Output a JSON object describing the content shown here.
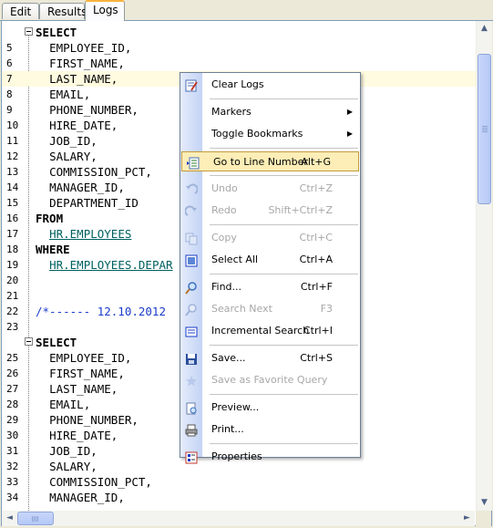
{
  "tabs": [
    {
      "label": "Edit"
    },
    {
      "label": "Results"
    },
    {
      "label": "Logs"
    }
  ],
  "code_lines": [
    {
      "num": "",
      "text": "SELECT",
      "style": "kw",
      "fold": true
    },
    {
      "num": "5",
      "text": "  EMPLOYEE_ID,"
    },
    {
      "num": "6",
      "text": "  FIRST_NAME,"
    },
    {
      "num": "7",
      "text": "  LAST_NAME,",
      "highlight": true
    },
    {
      "num": "8",
      "text": "  EMAIL,"
    },
    {
      "num": "9",
      "text": "  PHONE_NUMBER,"
    },
    {
      "num": "10",
      "text": "  HIRE_DATE,"
    },
    {
      "num": "11",
      "text": "  JOB_ID,"
    },
    {
      "num": "12",
      "text": "  SALARY,"
    },
    {
      "num": "13",
      "text": "  COMMISSION_PCT,"
    },
    {
      "num": "14",
      "text": "  MANAGER_ID,"
    },
    {
      "num": "15",
      "text": "  DEPARTMENT_ID"
    },
    {
      "num": "16",
      "text": "FROM",
      "style": "kw"
    },
    {
      "num": "17",
      "text": "  HR.EMPLOYEES",
      "style": "link"
    },
    {
      "num": "18",
      "text": "WHERE",
      "style": "kw"
    },
    {
      "num": "19",
      "text": "  HR.EMPLOYEES.DEPAR",
      "style": "link"
    },
    {
      "num": "20",
      "text": ""
    },
    {
      "num": "21",
      "text": ""
    },
    {
      "num": "22",
      "text": "/*------ 12.10.2012",
      "style": "cmt"
    },
    {
      "num": "23",
      "text": ""
    },
    {
      "num": "",
      "text": "SELECT",
      "style": "kw",
      "fold": true
    },
    {
      "num": "25",
      "text": "  EMPLOYEE_ID,"
    },
    {
      "num": "26",
      "text": "  FIRST_NAME,"
    },
    {
      "num": "27",
      "text": "  LAST_NAME,"
    },
    {
      "num": "28",
      "text": "  EMAIL,"
    },
    {
      "num": "29",
      "text": "  PHONE_NUMBER,"
    },
    {
      "num": "30",
      "text": "  HIRE_DATE,"
    },
    {
      "num": "31",
      "text": "  JOB_ID,"
    },
    {
      "num": "32",
      "text": "  SALARY,"
    },
    {
      "num": "33",
      "text": "  COMMISSION_PCT,"
    },
    {
      "num": "34",
      "text": "  MANAGER_ID,"
    }
  ],
  "menu": [
    {
      "label": "Clear Logs",
      "shortcut": "",
      "icon": "clear-logs-icon"
    },
    {
      "sep": true
    },
    {
      "label": "Markers",
      "submenu": true
    },
    {
      "label": "Toggle Bookmarks",
      "submenu": true
    },
    {
      "sep": true
    },
    {
      "label": "Go to Line Number",
      "shortcut": "Alt+G",
      "icon": "goto-line-icon",
      "selected": true
    },
    {
      "sep": true
    },
    {
      "label": "Undo",
      "shortcut": "Ctrl+Z",
      "disabled": true,
      "icon": "undo-icon"
    },
    {
      "label": "Redo",
      "shortcut": "Shift+Ctrl+Z",
      "disabled": true,
      "icon": "redo-icon"
    },
    {
      "sep": true
    },
    {
      "label": "Copy",
      "shortcut": "Ctrl+C",
      "disabled": true,
      "icon": "copy-icon"
    },
    {
      "label": "Select All",
      "shortcut": "Ctrl+A",
      "icon": "select-all-icon"
    },
    {
      "sep": true
    },
    {
      "label": "Find...",
      "shortcut": "Ctrl+F",
      "icon": "find-icon"
    },
    {
      "label": "Search Next",
      "shortcut": "F3",
      "disabled": true,
      "icon": "search-next-icon"
    },
    {
      "label": "Incremental Search",
      "shortcut": "Ctrl+I",
      "icon": "incremental-search-icon"
    },
    {
      "sep": true
    },
    {
      "label": "Save...",
      "shortcut": "Ctrl+S",
      "icon": "save-icon"
    },
    {
      "label": "Save as Favorite Query",
      "disabled": true,
      "icon": "favorite-icon"
    },
    {
      "sep": true
    },
    {
      "label": "Preview...",
      "icon": "preview-icon"
    },
    {
      "label": "Print...",
      "icon": "print-icon"
    },
    {
      "sep": true
    },
    {
      "label": "Properties",
      "icon": "properties-icon"
    }
  ]
}
